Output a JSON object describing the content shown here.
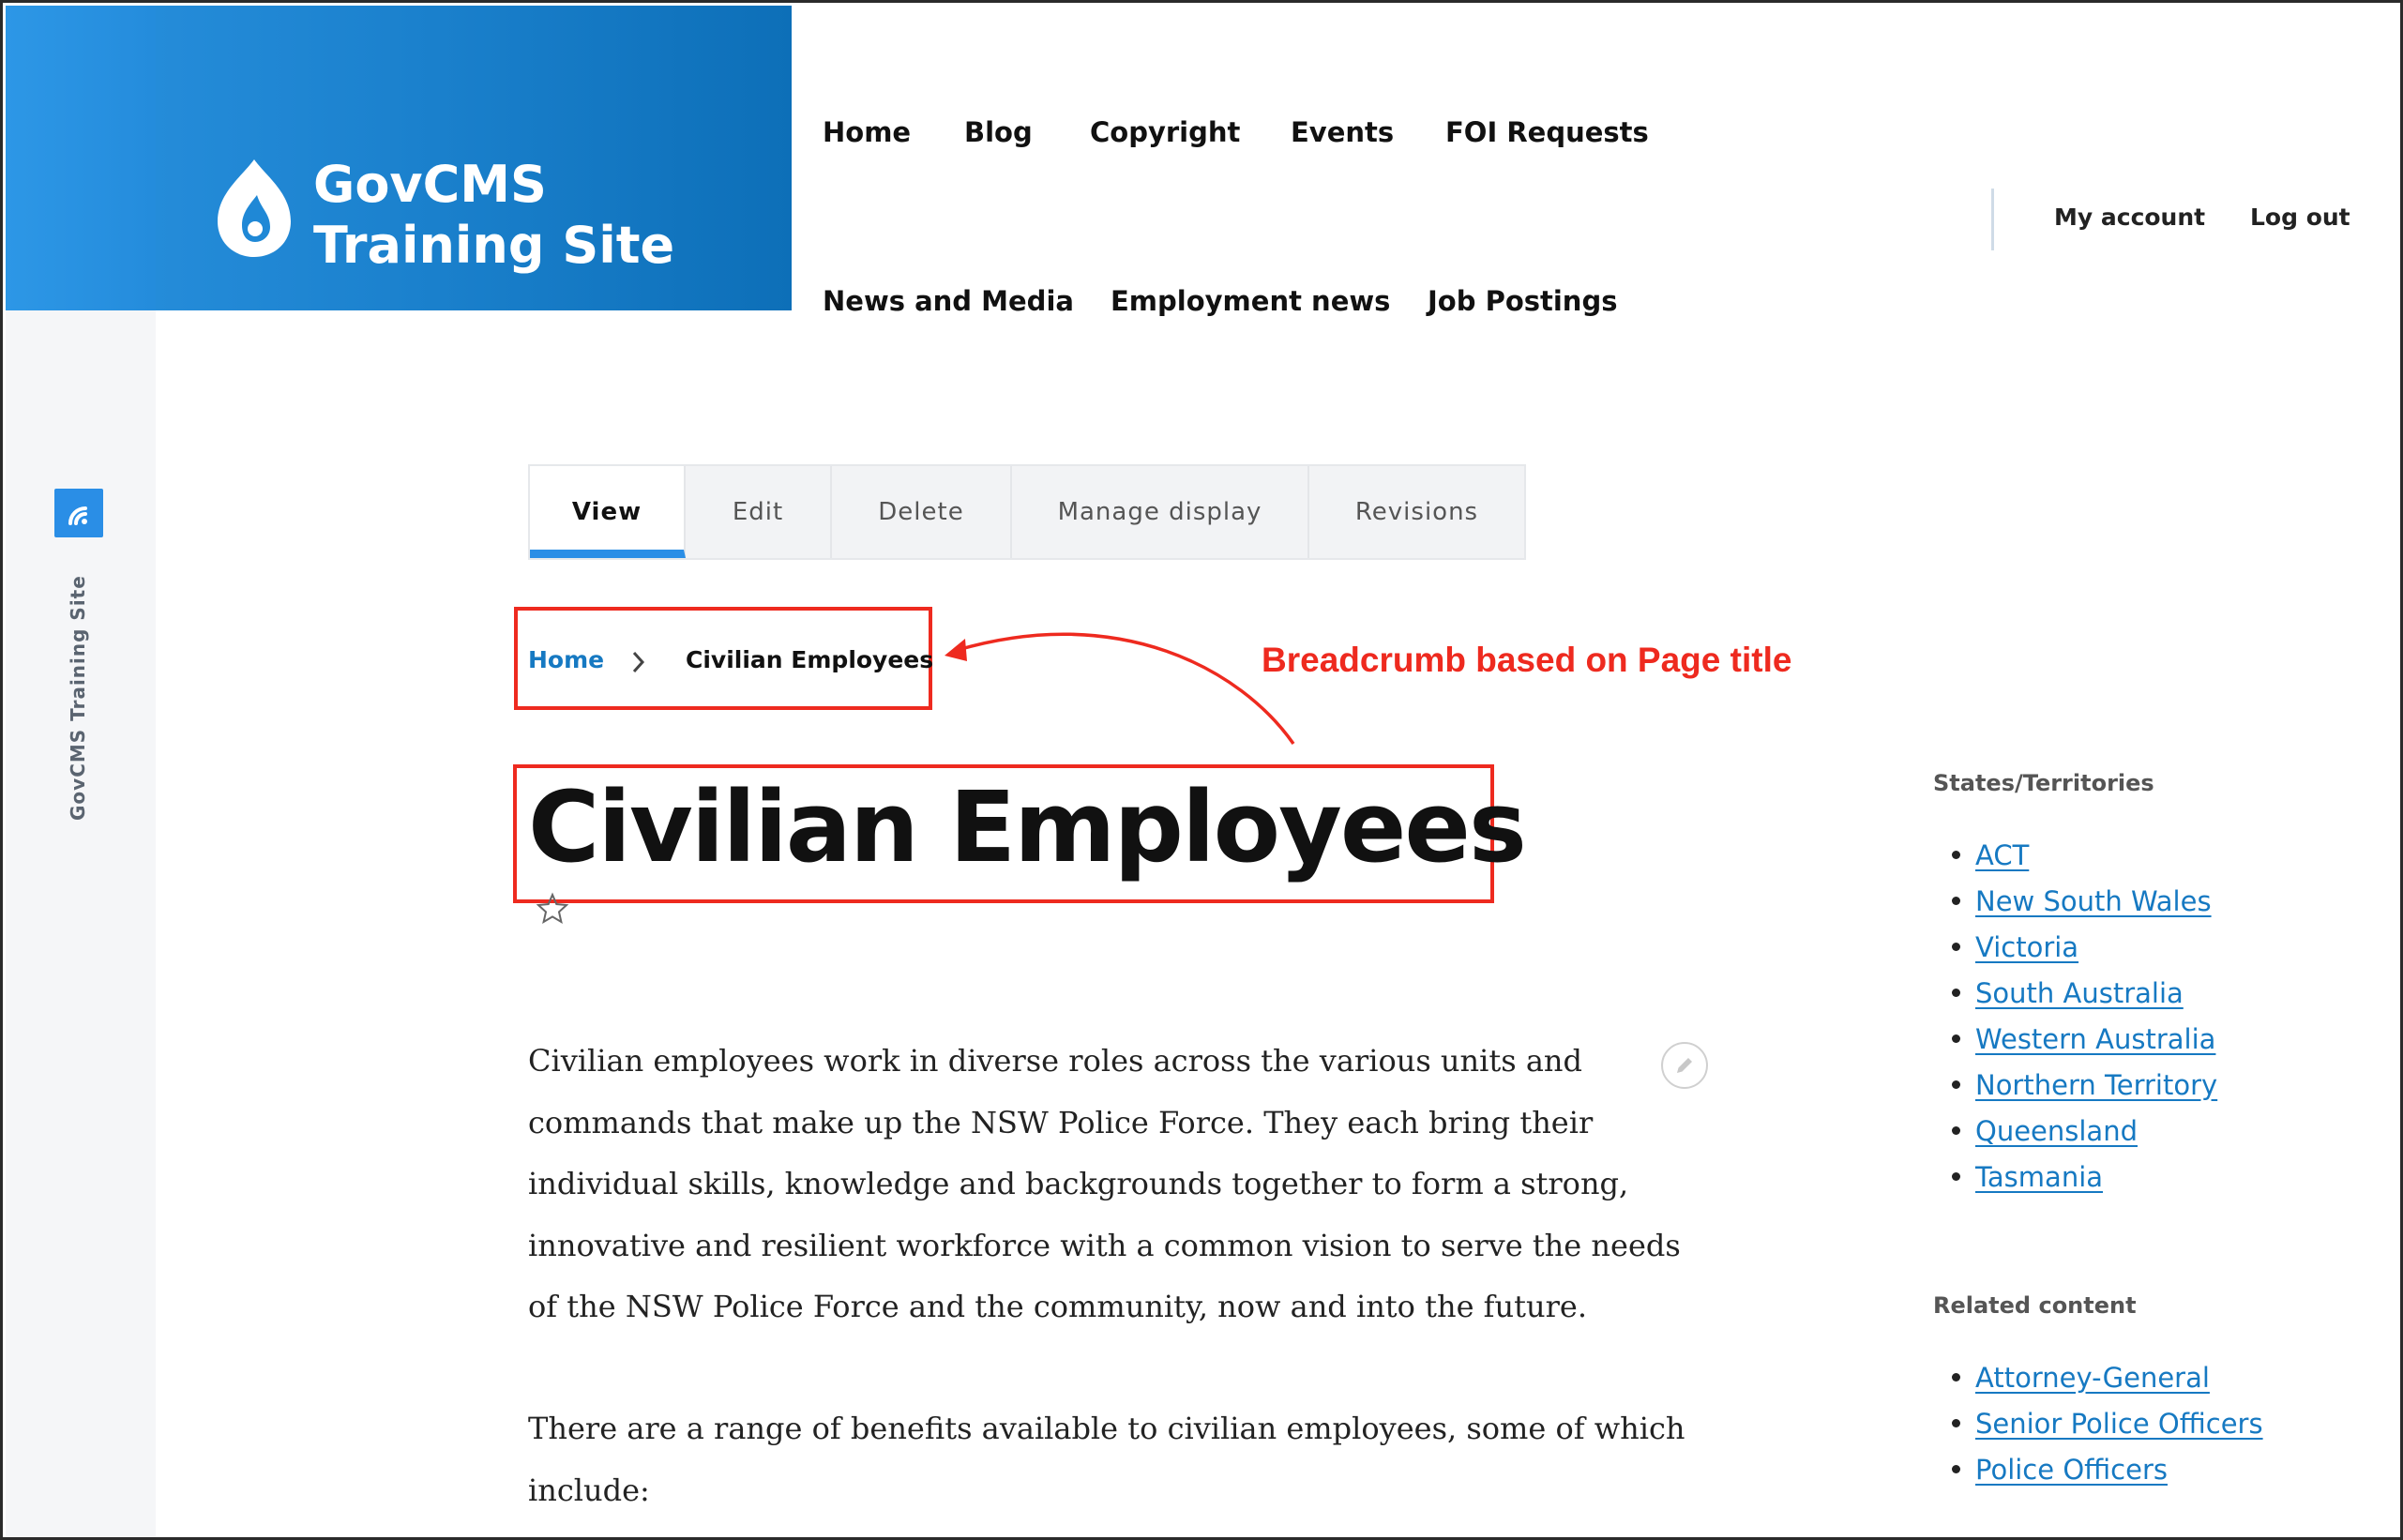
{
  "brand": {
    "site_name_line1": "GovCMS",
    "site_name_line2": "Training Site",
    "logo_icon": "drupal-drop-icon",
    "color": "#1a80cc"
  },
  "sidebar_rail": {
    "label": "GovCMS Training Site",
    "icon": "broadcast-icon",
    "color": "#2a8ee6"
  },
  "main_nav": {
    "items": [
      "Home",
      "Blog",
      "Copyright",
      "Events",
      "FOI Requests",
      "News and Media",
      "Employment news",
      "Job Postings"
    ]
  },
  "user_nav": {
    "my_account": "My account",
    "log_out": "Log out"
  },
  "local_tabs": [
    {
      "label": "View",
      "active": true
    },
    {
      "label": "Edit",
      "active": false
    },
    {
      "label": "Delete",
      "active": false
    },
    {
      "label": "Manage display",
      "active": false
    },
    {
      "label": "Revisions",
      "active": false
    }
  ],
  "breadcrumb": {
    "home": "Home",
    "current": "Civilian Employees"
  },
  "annotation": {
    "text": "Breadcrumb based on Page title",
    "color": "#ee2a1f"
  },
  "page": {
    "title": "Civilian Employees",
    "paragraph1": "Civilian employees work in diverse roles across the various units and commands that make up the NSW Police Force. They each bring their individual skills, knowledge and backgrounds together to form a strong, innovative and resilient workforce with a common vision to serve the needs of the NSW Police Force and the community, now and into the future.",
    "paragraph2": "There are a range of benefits available to civilian employees, some of which include:"
  },
  "side_blocks": {
    "states": {
      "heading": "States/Territories",
      "items": [
        "ACT",
        "New South Wales",
        "Victoria",
        "South Australia",
        "Western Australia",
        "Northern Territory",
        "Queensland",
        "Tasmania"
      ]
    },
    "related": {
      "heading": "Related content",
      "items": [
        "Attorney-General",
        "Senior Police Officers",
        "Police Officers"
      ]
    }
  },
  "link_color": "#1679c2"
}
